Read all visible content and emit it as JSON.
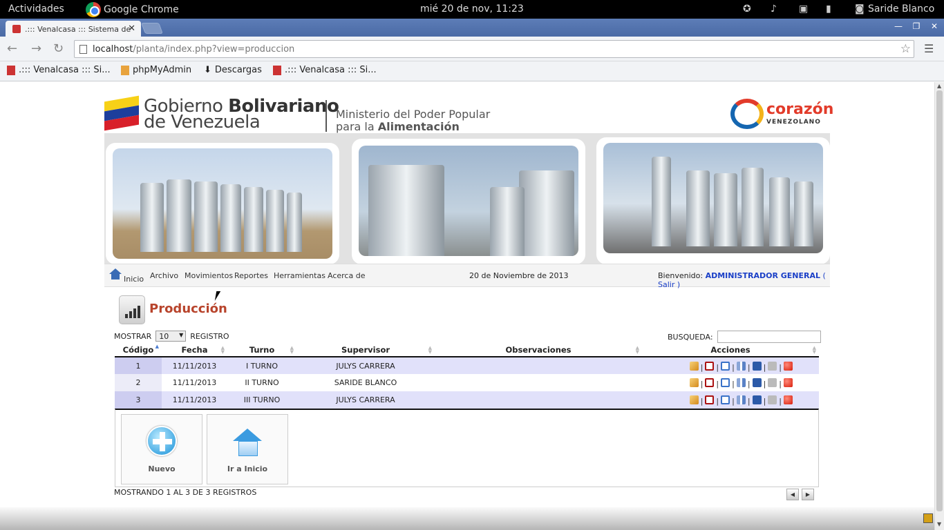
{
  "os": {
    "activities": "Actividades",
    "app_name": "Google Chrome",
    "clock": "mié 20 de nov, 11:23",
    "user": "Saride Blanco"
  },
  "browser": {
    "tab_title": ".::: Venalcasa ::: Sistema de",
    "url_host": "localhost",
    "url_path": "/planta/index.php?view=produccion",
    "bookmarks": [
      {
        "label": ".::: Venalcasa ::: Si..."
      },
      {
        "label": "phpMyAdmin"
      },
      {
        "label": "Descargas"
      },
      {
        "label": ".::: Venalcasa ::: Si..."
      }
    ]
  },
  "header": {
    "gob_line1_a": "Gobierno ",
    "gob_line1_b": "Bolivariano",
    "gob_line2": "de Venezuela",
    "min_line1": "Ministerio del Poder Popular",
    "min_line2_a": "para la ",
    "min_line2_b": "Alimentación",
    "cora": "corazón",
    "cora_sub": "VENEZOLANO",
    "flag_colors": [
      "#f7d117",
      "#1d3e9c",
      "#d8202a"
    ]
  },
  "nav": {
    "items": [
      "Inicio",
      "Archivo",
      "Movimientos",
      "Reportes",
      "Herramientas",
      "Acerca de"
    ],
    "date": "20 de Noviembre de 2013",
    "welcome": "Bienvenido:",
    "user": "ADMINISTRADOR GENERAL",
    "logout_open": "(",
    "logout": "Salir",
    "logout_close": ")"
  },
  "page": {
    "title": "Producción",
    "show_label": "MOSTRAR",
    "show_value": "10",
    "records_label": "REGISTRO",
    "search_label": "BUSQUEDA:",
    "search_value": ""
  },
  "table": {
    "headers": [
      "Código",
      "Fecha",
      "Turno",
      "Supervisor",
      "Observaciones",
      "Acciones"
    ],
    "rows": [
      {
        "codigo": "1",
        "fecha": "11/11/2013",
        "turno": "I TURNO",
        "supervisor": "JULYS CARRERA",
        "obs": ""
      },
      {
        "codigo": "2",
        "fecha": "11/11/2013",
        "turno": "II TURNO",
        "supervisor": "SARIDE BLANCO",
        "obs": ""
      },
      {
        "codigo": "3",
        "fecha": "11/11/2013",
        "turno": "III TURNO",
        "supervisor": "JULYS CARRERA",
        "obs": ""
      }
    ],
    "action_icons": [
      "edit-icon",
      "delete-icon",
      "grid-icon",
      "chart-icon",
      "book-icon",
      "print-icon",
      "stop-icon"
    ]
  },
  "buttons": {
    "new": "Nuevo",
    "home": "Ir a Inicio"
  },
  "footer": {
    "info": "MOSTRANDO 1 AL 3 DE 3 REGISTROS"
  }
}
